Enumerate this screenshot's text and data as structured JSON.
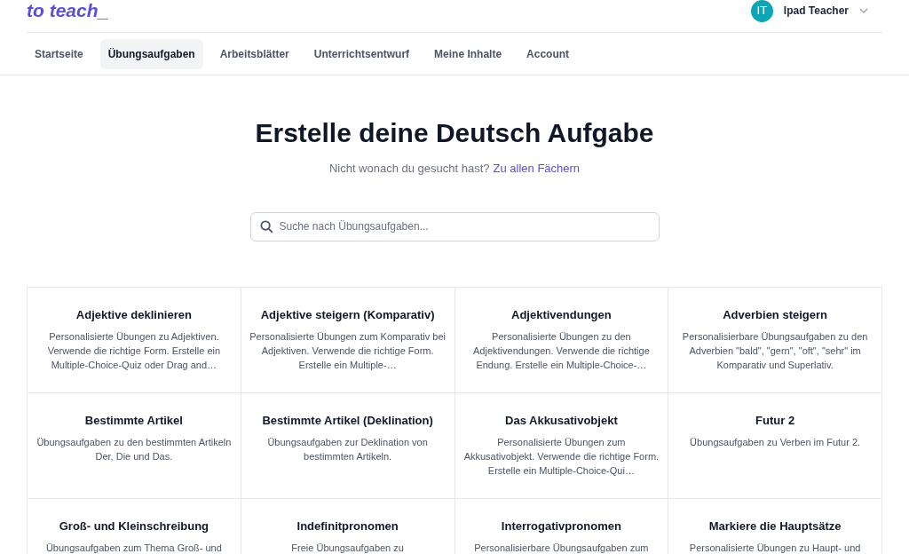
{
  "header": {
    "logo": "to teach_",
    "user": {
      "initials": "IT",
      "name": "Ipad Teacher"
    }
  },
  "nav": [
    {
      "label": "Startseite",
      "selected": false
    },
    {
      "label": "Übungsaufgaben",
      "selected": true
    },
    {
      "label": "Arbeitsblätter",
      "selected": false
    },
    {
      "label": "Unterrichtsentwurf",
      "selected": false
    },
    {
      "label": "Meine Inhalte",
      "selected": false
    },
    {
      "label": "Account",
      "selected": false
    }
  ],
  "hero": {
    "title": "Erstelle deine Deutsch Aufgabe",
    "subtitle": "Nicht wonach du gesucht hast?",
    "link": "Zu allen Fächern"
  },
  "search": {
    "placeholder": "Suche nach Übungsaufgaben..."
  },
  "cards": [
    {
      "title": "Adjektive deklinieren",
      "description": "Personalisierte Übungen zu Adjektiven. Verwende die richtige Form. Erstelle ein Multiple-Choice-Quiz oder Drag and…"
    },
    {
      "title": "Adjektive steigern (Komparativ)",
      "description": "Personalisierte Übungen zum Komparativ bei Adjektiven. Verwende die richtige Form. Erstelle ein Multiple-…"
    },
    {
      "title": "Adjektivendungen",
      "description": "Personalisierte Übungen zu den Adjektivendungen. Verwende die richtige Endung. Erstelle ein Multiple-Choice-…"
    },
    {
      "title": "Adverbien steigern",
      "description": "Personalisierbare Übungsaufgaben zu den Adverbien \"bald\", \"gern\", \"oft\", \"sehr\" im Komparativ und Superlativ."
    },
    {
      "title": "Bestimmte Artikel",
      "description": "Übungsaufgaben zu den bestimmten Artikeln Der, Die und Das."
    },
    {
      "title": "Bestimmte Artikel (Deklination)",
      "description": "Übungsaufgaben zur Deklination von bestimmten Artikeln."
    },
    {
      "title": "Das Akkusativobjekt",
      "description": "Personalisierte Übungen zum Akkusativobjekt. Verwende die richtige Form. Erstelle ein Multiple-Choice-Qui…"
    },
    {
      "title": "Futur 2",
      "description": "Übungsaufgaben zu Verben im Futur 2."
    },
    {
      "title": "Groß- und Kleinschreibung",
      "description": "Übungsaufgaben zum Thema Groß- und"
    },
    {
      "title": "Indefinitpronomen",
      "description": "Freie Übungsaufgaben zu"
    },
    {
      "title": "Interrogativpronomen",
      "description": "Personalisierbare Übungsaufgaben zum"
    },
    {
      "title": "Markiere die Hauptsätze",
      "description": "Personalisierte Übungen zu Haupt- und"
    }
  ]
}
